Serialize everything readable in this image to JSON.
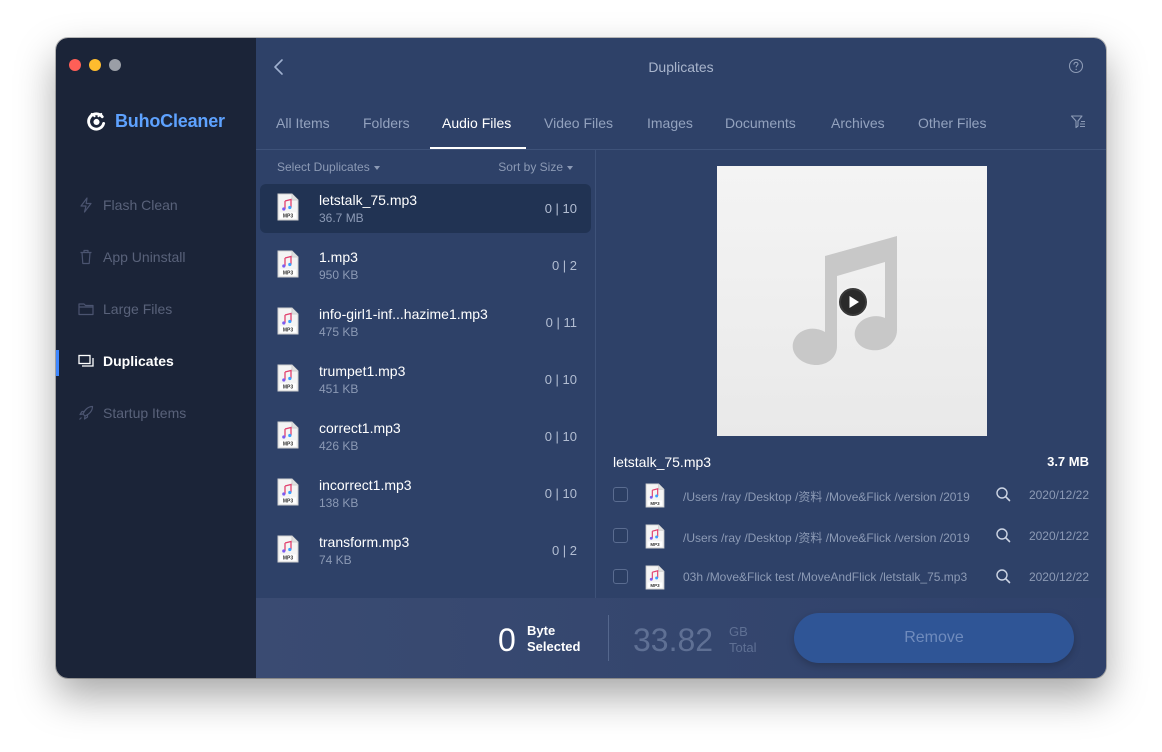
{
  "app": {
    "name": "BuhoCleaner",
    "brand_color": "#5ea2ff"
  },
  "sidebar": {
    "items": [
      {
        "label": "Flash Clean",
        "icon": "bolt-icon",
        "active": false
      },
      {
        "label": "App Uninstall",
        "icon": "trash-icon",
        "active": false
      },
      {
        "label": "Large Files",
        "icon": "folder-icon",
        "active": false
      },
      {
        "label": "Duplicates",
        "icon": "duplicates-icon",
        "active": true
      },
      {
        "label": "Startup Items",
        "icon": "rocket-icon",
        "active": false
      }
    ]
  },
  "header": {
    "title": "Duplicates"
  },
  "tabs": [
    {
      "label": "All Items",
      "active": false
    },
    {
      "label": "Folders",
      "active": false
    },
    {
      "label": "Audio Files",
      "active": true
    },
    {
      "label": "Video Files",
      "active": false
    },
    {
      "label": "Images",
      "active": false
    },
    {
      "label": "Documents",
      "active": false
    },
    {
      "label": "Archives",
      "active": false
    },
    {
      "label": "Other Files",
      "active": false
    }
  ],
  "list": {
    "select_label": "Select Duplicates",
    "sort_label": "Sort by Size",
    "files": [
      {
        "name": "letstalk_75.mp3",
        "size": "36.7 MB",
        "count": "0 | 10",
        "selected": true
      },
      {
        "name": "1.mp3",
        "size": "950 KB",
        "count": "0 | 2",
        "selected": false
      },
      {
        "name": "info-girl1-inf...hazime1.mp3",
        "size": "475 KB",
        "count": "0 | 11",
        "selected": false
      },
      {
        "name": "trumpet1.mp3",
        "size": "451 KB",
        "count": "0 | 10",
        "selected": false
      },
      {
        "name": "correct1.mp3",
        "size": "426 KB",
        "count": "0 | 10",
        "selected": false
      },
      {
        "name": "incorrect1.mp3",
        "size": "138 KB",
        "count": "0 | 10",
        "selected": false
      },
      {
        "name": "transform.mp3",
        "size": "74 KB",
        "count": "0 | 2",
        "selected": false
      }
    ]
  },
  "preview": {
    "file_name": "letstalk_75.mp3",
    "file_size": "3.7 MB",
    "paths": [
      {
        "path": "/Users /ray /Desktop /资料 /Move&Flick /version /2019",
        "date": "2020/12/22"
      },
      {
        "path": "/Users /ray /Desktop /资料 /Move&Flick /version /2019",
        "date": "2020/12/22"
      },
      {
        "path": "03h /Move&Flick test /MoveAndFlick /letstalk_75.mp3",
        "date": "2020/12/22"
      }
    ]
  },
  "footer": {
    "selected_value": "0",
    "selected_unit_line1": "Byte",
    "selected_unit_line2": "Selected",
    "total_value": "33.82",
    "total_unit_line1": "GB",
    "total_unit_line2": "Total",
    "remove_label": "Remove"
  }
}
